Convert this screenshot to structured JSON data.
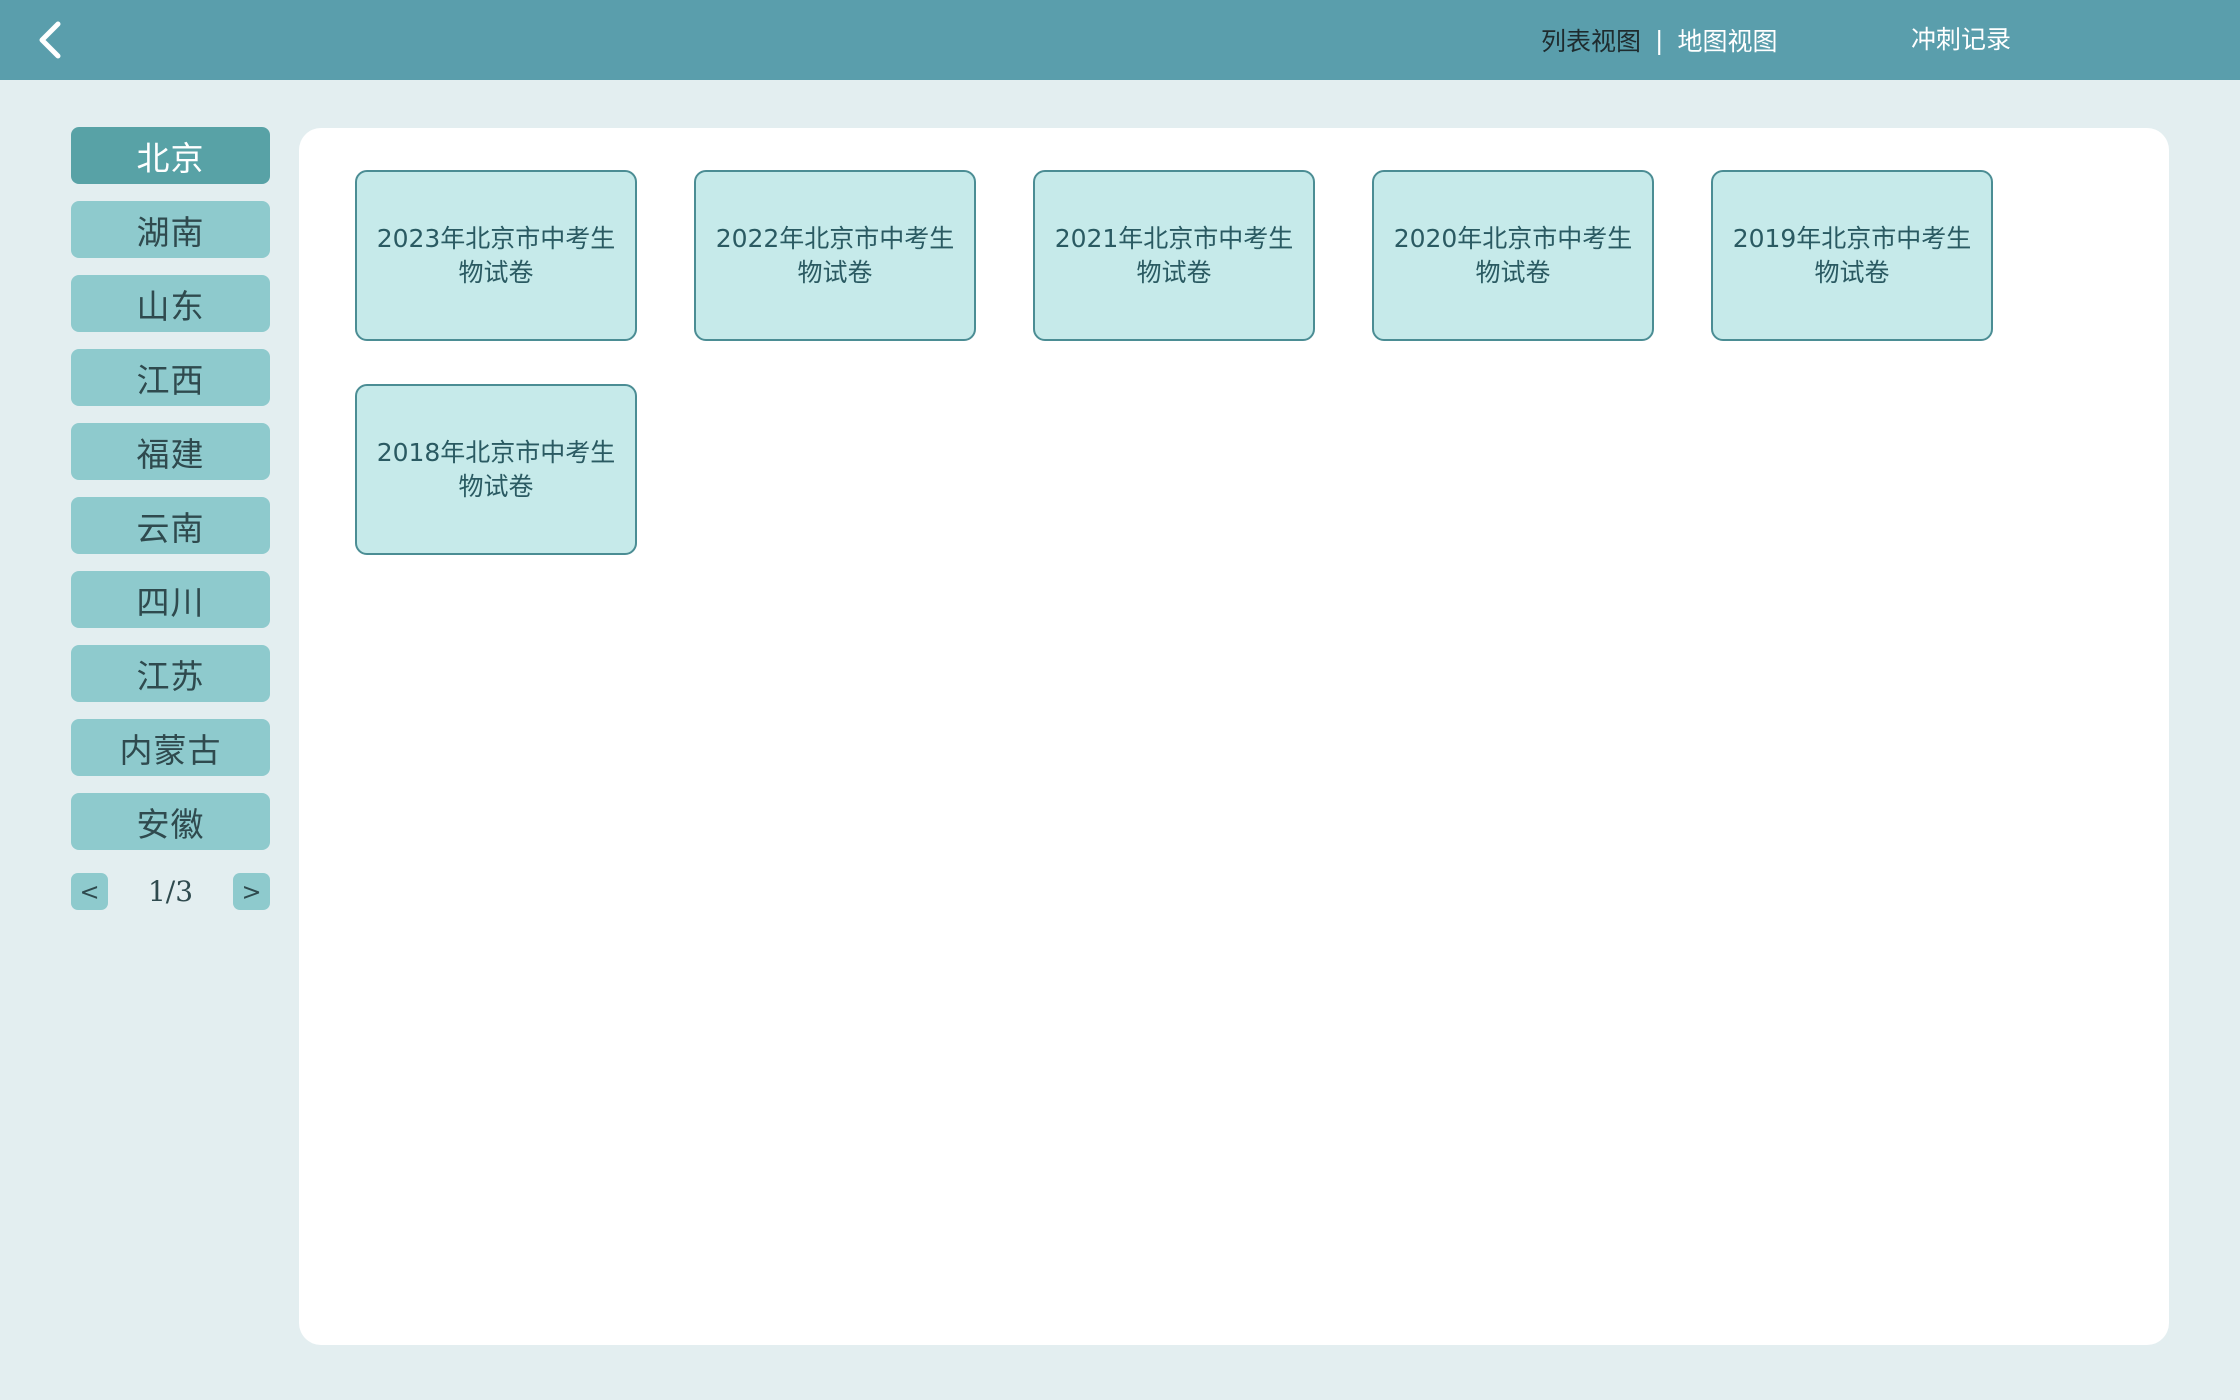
{
  "header": {
    "back_icon": "chevron-left-icon",
    "tabs": [
      {
        "label": "列表视图",
        "active": true
      },
      {
        "label": "地图视图",
        "active": false
      }
    ],
    "separator": "|",
    "sprint_record_label": "冲刺记录"
  },
  "sidebar": {
    "items": [
      {
        "label": "北京",
        "active": true
      },
      {
        "label": "湖南",
        "active": false
      },
      {
        "label": "山东",
        "active": false
      },
      {
        "label": "江西",
        "active": false
      },
      {
        "label": "福建",
        "active": false
      },
      {
        "label": "云南",
        "active": false
      },
      {
        "label": "四川",
        "active": false
      },
      {
        "label": "江苏",
        "active": false
      },
      {
        "label": "内蒙古",
        "active": false
      },
      {
        "label": "安徽",
        "active": false
      }
    ],
    "pager": {
      "prev_label": "<",
      "next_label": ">",
      "page_text": "1/3"
    }
  },
  "main": {
    "papers": [
      {
        "title": "2023年北京市中考生物试卷"
      },
      {
        "title": "2022年北京市中考生物试卷"
      },
      {
        "title": "2021年北京市中考生物试卷"
      },
      {
        "title": "2020年北京市中考生物试卷"
      },
      {
        "title": "2019年北京市中考生物试卷"
      },
      {
        "title": "2018年北京市中考生物试卷"
      }
    ]
  },
  "colors": {
    "header_bg": "#5a9eac",
    "page_bg": "#e3eef0",
    "region_btn": "#8ecacd",
    "region_btn_active": "#58a2a6",
    "card_bg": "#c6eaea",
    "card_border": "#4b8d94"
  }
}
